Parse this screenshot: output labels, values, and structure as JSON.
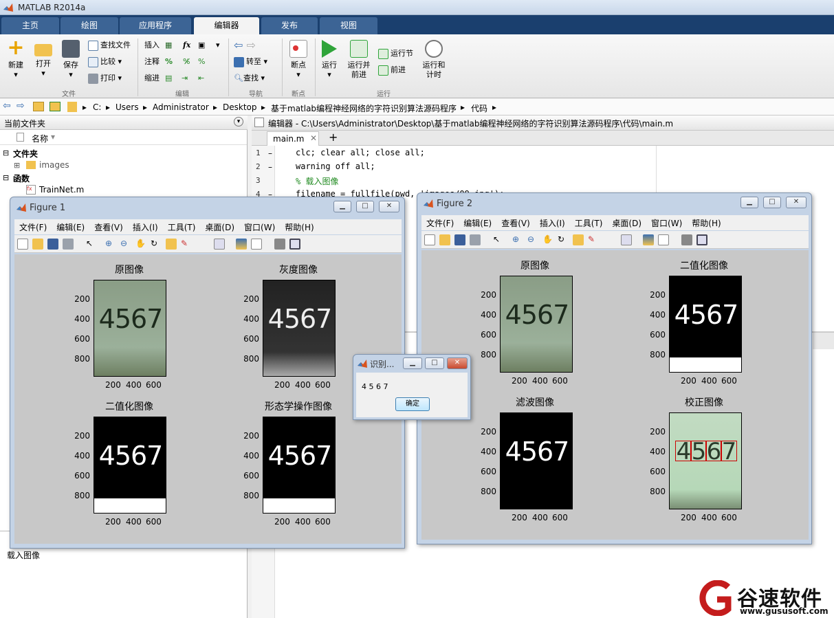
{
  "app": {
    "title": "MATLAB R2014a"
  },
  "tabs": [
    "主页",
    "绘图",
    "应用程序",
    "编辑器",
    "发布",
    "视图"
  ],
  "ribbon": {
    "new": "新建",
    "open": "打开",
    "save": "保存",
    "find_files": "查找文件",
    "compare": "比较",
    "print": "打印",
    "insert": "插入",
    "comment": "注释",
    "indent": "缩进",
    "fx": "fx",
    "goto": "转至",
    "find": "查找",
    "breakpoints": "断点",
    "run": "运行",
    "run_advance_1": "运行并",
    "run_advance_2": "前进",
    "run_section": "运行节",
    "advance": "前进",
    "run_time_1": "运行和",
    "run_time_2": "计时",
    "groups": {
      "file": "文件",
      "edit": "编辑",
      "navigate": "导航",
      "bp": "断点",
      "run": "运行"
    }
  },
  "breadcrumb": [
    "C:",
    "Users",
    "Administrator",
    "Desktop",
    "基于matlab编程神经网络的字符识别算法源码程序",
    "代码"
  ],
  "left_panel": {
    "title": "当前文件夹",
    "col_name": "名称",
    "folder_section": "文件夹",
    "folder_item": "images",
    "func_section": "函数",
    "func_item": "TrainNet.m",
    "status_text": "载入图像"
  },
  "editor": {
    "header": "编辑器 - C:\\Users\\Administrator\\Desktop\\基于matlab编程神经网络的字符识别算法源码程序\\代码\\main.m",
    "tab": "main.m",
    "add_tab": "+",
    "lines": [
      {
        "n": "1",
        "code": "clc; clear all; close all;"
      },
      {
        "n": "2",
        "code": "warning off all;"
      },
      {
        "n": "3",
        "code": "% 载入图像"
      },
      {
        "n": "4",
        "code": "filename = fullfile(pwd, 'images/09.jpg');"
      }
    ]
  },
  "figure1": {
    "title": "Figure 1",
    "menu": [
      "文件(F)",
      "编辑(E)",
      "查看(V)",
      "插入(I)",
      "工具(T)",
      "桌面(D)",
      "窗口(W)",
      "帮助(H)"
    ],
    "plots": [
      {
        "title": "原图像",
        "digits": "4567"
      },
      {
        "title": "灰度图像",
        "digits": "4567"
      },
      {
        "title": "二值化图像",
        "digits": "4567"
      },
      {
        "title": "形态学操作图像",
        "digits": "4567"
      }
    ]
  },
  "figure2": {
    "title": "Figure 2",
    "menu": [
      "文件(F)",
      "编辑(E)",
      "查看(V)",
      "插入(I)",
      "工具(T)",
      "桌面(D)",
      "窗口(W)",
      "帮助(H)"
    ],
    "plots": [
      {
        "title": "原图像",
        "digits": "4567"
      },
      {
        "title": "二值化图像",
        "digits": "4567"
      },
      {
        "title": "滤波图像",
        "digits": "4567"
      },
      {
        "title": "校正图像",
        "digits": "4567"
      }
    ]
  },
  "ytick_labels": [
    "200",
    "400",
    "600",
    "800"
  ],
  "xtick_labels": [
    "200",
    "400",
    "600"
  ],
  "dialog": {
    "title": "识别...",
    "result": "4 5 6 7",
    "ok": "确定"
  },
  "watermark": {
    "brand": "谷速软件",
    "url": "www.gususoft.com"
  }
}
